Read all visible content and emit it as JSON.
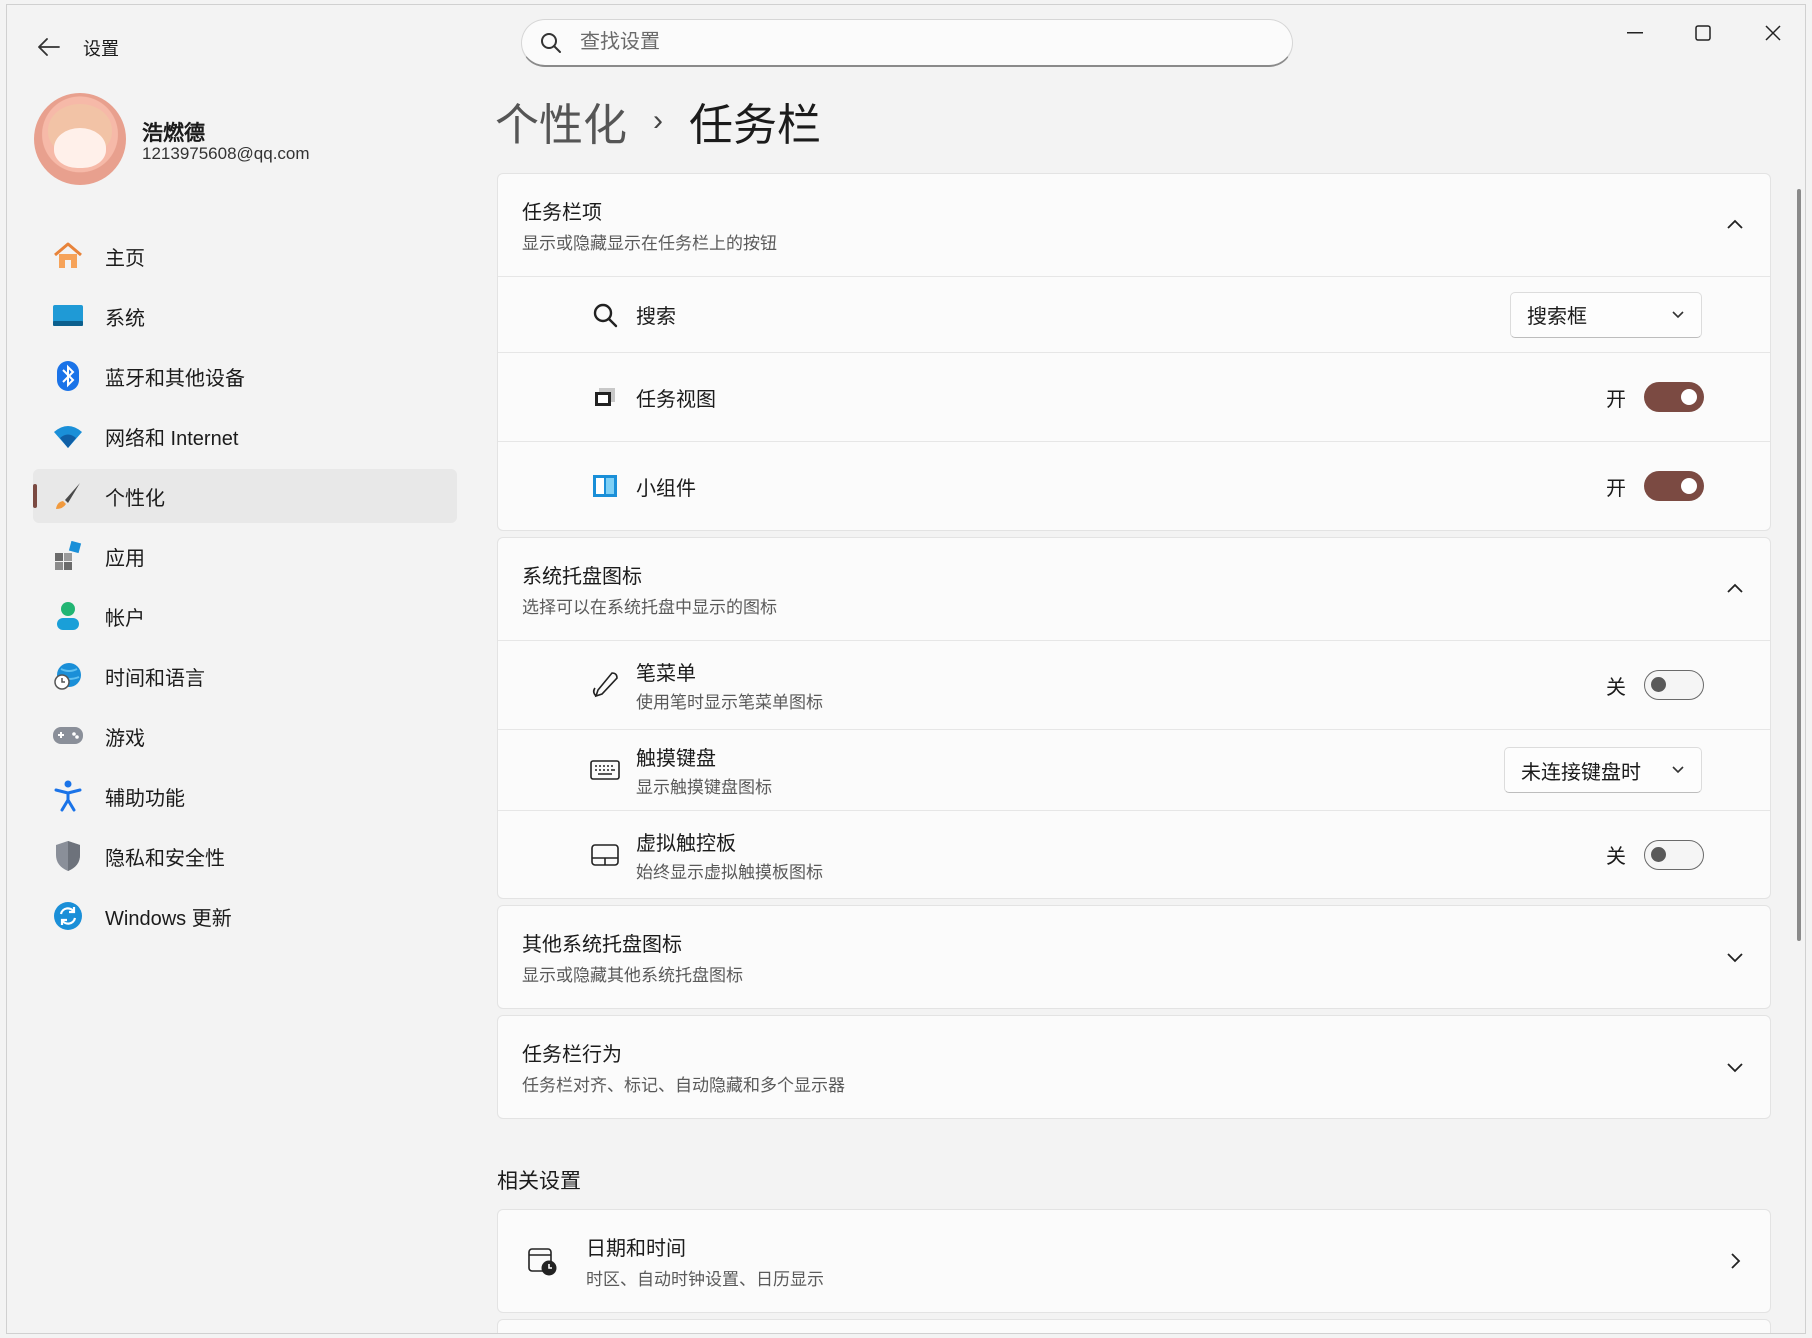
{
  "window": {
    "title": "设置",
    "search_placeholder": "查找设置"
  },
  "user": {
    "name": "浩燃德",
    "email": "1213975608@qq.com"
  },
  "nav": {
    "items": [
      {
        "label": "主页",
        "icon": "home-icon"
      },
      {
        "label": "系统",
        "icon": "system-icon"
      },
      {
        "label": "蓝牙和其他设备",
        "icon": "bluetooth-icon"
      },
      {
        "label": "网络和 Internet",
        "icon": "wifi-icon"
      },
      {
        "label": "个性化",
        "icon": "brush-icon",
        "active": true
      },
      {
        "label": "应用",
        "icon": "apps-icon"
      },
      {
        "label": "帐户",
        "icon": "account-icon"
      },
      {
        "label": "时间和语言",
        "icon": "globe-clock-icon"
      },
      {
        "label": "游戏",
        "icon": "gamepad-icon"
      },
      {
        "label": "辅助功能",
        "icon": "accessibility-icon"
      },
      {
        "label": "隐私和安全性",
        "icon": "shield-icon"
      },
      {
        "label": "Windows 更新",
        "icon": "update-icon"
      }
    ]
  },
  "breadcrumb": {
    "parent": "个性化",
    "separator": "›",
    "current": "任务栏"
  },
  "taskbar_items": {
    "title": "任务栏项",
    "subtitle": "显示或隐藏显示在任务栏上的按钮",
    "rows": {
      "search": {
        "label": "搜索",
        "value": "搜索框"
      },
      "task_view": {
        "label": "任务视图",
        "state": "开"
      },
      "widgets": {
        "label": "小组件",
        "state": "开"
      }
    }
  },
  "tray_icons": {
    "title": "系统托盘图标",
    "subtitle": "选择可以在系统托盘中显示的图标",
    "rows": {
      "pen_menu": {
        "label": "笔菜单",
        "sub": "使用笔时显示笔菜单图标",
        "state": "关"
      },
      "touch_keyboard": {
        "label": "触摸键盘",
        "sub": "显示触摸键盘图标",
        "value": "未连接键盘时"
      },
      "virtual_touchpad": {
        "label": "虚拟触控板",
        "sub": "始终显示虚拟触摸板图标",
        "state": "关"
      }
    }
  },
  "other_tray": {
    "title": "其他系统托盘图标",
    "subtitle": "显示或隐藏其他系统托盘图标"
  },
  "behaviors": {
    "title": "任务栏行为",
    "subtitle": "任务栏对齐、标记、自动隐藏和多个显示器"
  },
  "related": {
    "title": "相关设置",
    "datetime": {
      "label": "日期和时间",
      "sub": "时区、自动时钟设置、日历显示"
    }
  },
  "colors": {
    "accent": "#7b4a42"
  }
}
